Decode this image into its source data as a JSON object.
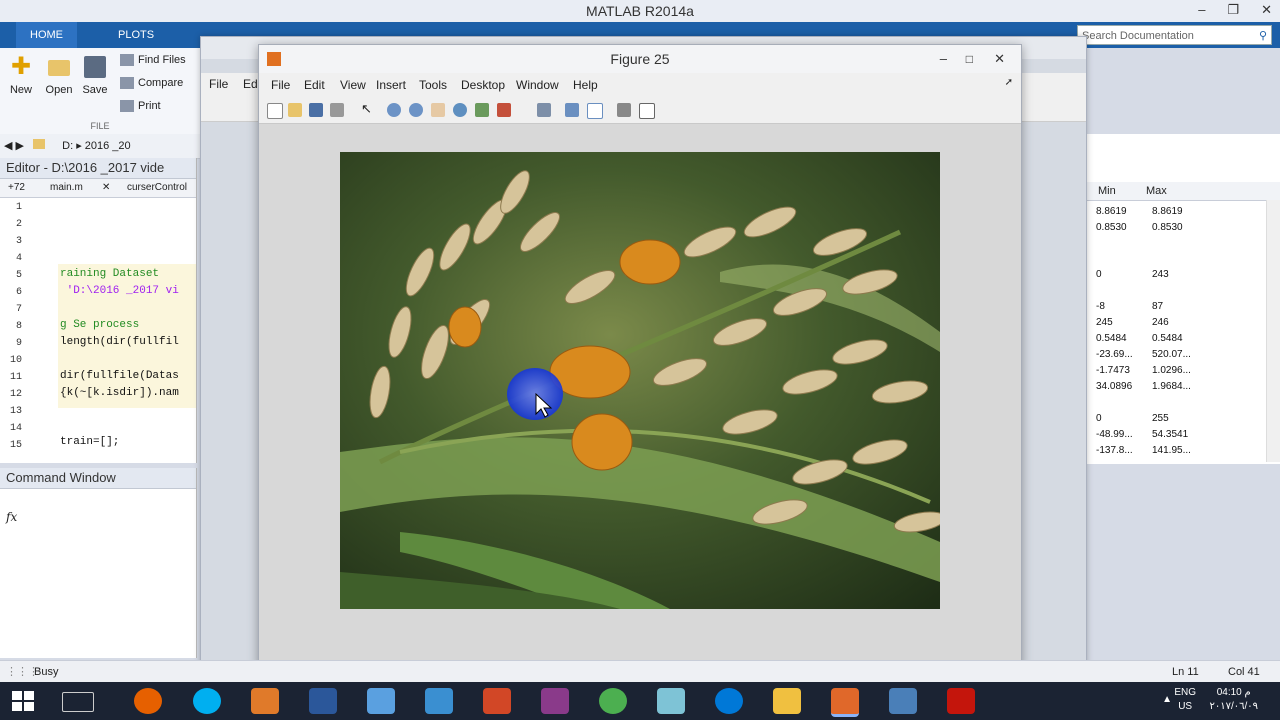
{
  "app": {
    "title": "MATLAB R2014a"
  },
  "ribbon": {
    "tabs": [
      "HOME",
      "PLOTS"
    ],
    "buttons": {
      "new": "New",
      "open": "Open",
      "save": "Save"
    },
    "small": {
      "find_files": "Find Files",
      "compare": "Compare",
      "print": "Print"
    },
    "group_label": "FILE"
  },
  "search": {
    "placeholder": "Search Documentation"
  },
  "pathbar": {
    "drive": "D:",
    "folder": "2016 _20"
  },
  "editor": {
    "title": "Editor - D:\\2016 _2017 vide",
    "tab_count": "+72",
    "tabs": [
      "main.m",
      "curserControl"
    ],
    "lines": [
      "1",
      "2",
      "3",
      "4",
      "5",
      "6",
      "7",
      "8",
      "9",
      "10",
      "11",
      "12",
      "13",
      "14",
      "15"
    ],
    "code": {
      "l5": "raining Dataset",
      "l6": " 'D:\\2016 _2017 vi",
      "l8": "g Se process",
      "l9": "length(dir(fullfil",
      "l11": "dir(fullfile(Datas",
      "l12": "{k(~[k.isdir]).nam",
      "l15": "train=[];"
    }
  },
  "command_window": {
    "title": "Command Window",
    "prompt": "fx"
  },
  "status": {
    "state": "Busy",
    "line": "Ln  11",
    "col": "Col  41"
  },
  "workspace": {
    "headers": [
      "Min",
      "Max"
    ],
    "rows": [
      [
        "8.8619",
        "8.8619"
      ],
      [
        "0.8530",
        "0.8530"
      ],
      [
        "0",
        "243"
      ],
      [
        "-8",
        "87"
      ],
      [
        "245",
        "246"
      ],
      [
        "0.5484",
        "0.5484"
      ],
      [
        "-23.69...",
        "520.07..."
      ],
      [
        "-1.7473",
        "1.0296..."
      ],
      [
        "34.0896",
        "1.9684..."
      ],
      [
        "0",
        "255"
      ],
      [
        "-48.99...",
        "54.3541"
      ],
      [
        "-137.8...",
        "141.95..."
      ]
    ]
  },
  "figure_back": {
    "menu": [
      "File",
      "Ed"
    ]
  },
  "figure": {
    "title": "Figure 25",
    "menu": [
      "File",
      "Edit",
      "View",
      "Insert",
      "Tools",
      "Desktop",
      "Window",
      "Help"
    ]
  },
  "taskbar": {
    "lang_top": "ENG",
    "lang_bottom": "US",
    "time": "04:10 م",
    "date": "٢٠١٧/٠٦/٠٩"
  },
  "colors": {
    "ribbon_blue": "#1c5fa8",
    "taskbar": "#1b2333",
    "figure_bg": "#d8d8d8"
  }
}
